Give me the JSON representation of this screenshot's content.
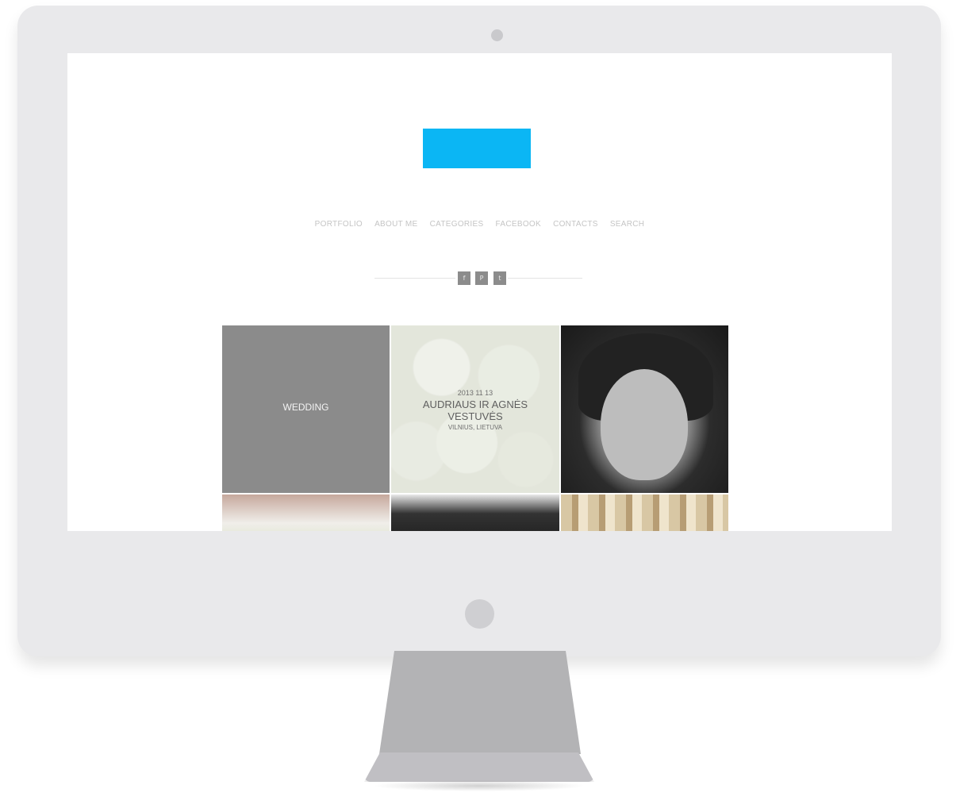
{
  "nav": {
    "items": [
      {
        "label": "PORTFOLIO"
      },
      {
        "label": "ABOUT ME"
      },
      {
        "label": "CATEGORIES"
      },
      {
        "label": "FACEBOOK"
      },
      {
        "label": "CONTACTS"
      },
      {
        "label": "SEARCH"
      }
    ]
  },
  "social": [
    {
      "icon": "facebook-icon",
      "glyph": "f"
    },
    {
      "icon": "pinterest-icon",
      "glyph": "P"
    },
    {
      "icon": "twitter-icon",
      "glyph": "t"
    }
  ],
  "grid": {
    "category_label": "WEDDING",
    "featured": {
      "date": "2013 11 13",
      "title": "AUDRIAUS IR AGNĖS VESTUVĖS",
      "location": "VILNIUS, LIETUVA"
    }
  },
  "colors": {
    "accent": "#0bb6f4",
    "frame": "#e9e9eb",
    "stand": "#b3b3b5"
  }
}
